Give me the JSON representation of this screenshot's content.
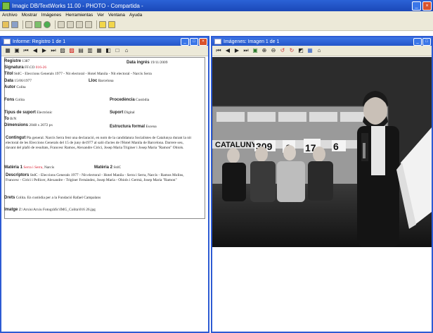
{
  "app": {
    "title": "Imagic DB/TextWorks 11.00 - PHOTO - Compartida -"
  },
  "menu": [
    "Archivo",
    "Mostrar",
    "Imágenes",
    "Herramientas",
    "Ver",
    "Ventana",
    "Ayuda"
  ],
  "left_pane": {
    "title": "Informe: Registro 1 de 1"
  },
  "right_pane": {
    "title": "Imágenes: Imagen 1 de 1"
  },
  "record": {
    "registre_label": "Registre",
    "registre_value": "1387",
    "data_ingres_label": "Data ingrés",
    "data_ingres_value": "19/11/2009",
    "signatura_label": "Signatura",
    "signatura_value_a": "FF.CO",
    "signatura_value_b": "016-26",
    "titol_label": "Títol",
    "titol_value": "StdC - Eleccions Generals 1977 - Nit electoral - Hotel Manila - Nit electoral - Narcís Serra",
    "data_label": "Data",
    "data_value": "15/06/1977",
    "lloc_label": "Lloc",
    "lloc_value": "Barcelona",
    "autor_label": "Autor",
    "autor_value": "Colita",
    "fons_label": "Fons",
    "fons_value": "Colita",
    "procedencia_label": "Procedència",
    "procedencia_value": "Custòdia",
    "tipus_label": "Tipus de suport",
    "tipus_value": "Electrònic",
    "suport_label": "Suport",
    "suport_value": "Digital",
    "to_label": "To",
    "to_value": "B/N",
    "dimensions_label": "Dimensions",
    "dimensions_value": "2048 x 2072 px",
    "estructura_label": "Estructura formal",
    "estructura_value": "Escena",
    "contingut_label": "Contingut",
    "contingut_value": "Pla general. Narcís Serra fent una declaració, en nom de la candidatura Socialistes de Catalunya durant la nit electoral de les Eleccions Generals del 15 de juny de1977 al saló d'actes de l'Hotel Manila de Barcelona. Darrere seu, davant del plafó de resultats, Francesc Ramos, Alexandre Cirici, Josep Maria Triginer i Josep Maria \"Ramon\" Obiols.",
    "materia1_label": "Matèria 1",
    "materia1_value_red": "Serra i Serra,",
    "materia1_value": " Narcís",
    "materia2_label": "Matèria 2",
    "materia2_value": "StdC",
    "descriptors_label": "Descriptors",
    "descriptors_value": "StdC - Eleccions Generals 1977 - Nit electoral - Hotel Manila - Serra i Serra, Narcís - Ramos Molins, Francesc - Cirici i Pellicer, Alexandre - Triginer Fernández, Josep Maria - Obiols i Germà, Josep Maria \"Ramon\"",
    "drets_label": "Drets",
    "drets_value": "Colita. En custòdia per a la Fundació Rafael Campalans",
    "imatge_label": "Imatge",
    "imatge_value": "Z:\\Arxiu\\Arxiu Fotogràfic\\IMG_Colita\\016 26.jpg"
  },
  "photo": {
    "board_text": "CATALUNYA"
  }
}
